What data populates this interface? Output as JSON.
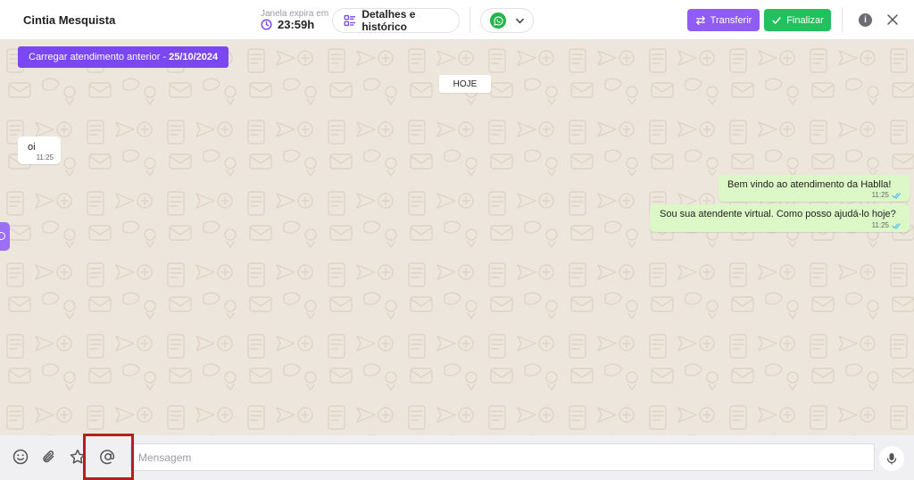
{
  "header": {
    "contact_name": "Cintia Mesquista",
    "window_label": "Janela expira em",
    "window_time": "23:59h",
    "details_label": "Detalhes e histórico",
    "channel_icon": "whatsapp-icon",
    "transfer_label": "Transferir",
    "finish_label": "Finalizar"
  },
  "chat": {
    "load_previous_label": "Carregar atendimento anterior -",
    "load_previous_date": "25/10/2024",
    "date_separator": "HOJE",
    "messages": [
      {
        "direction": "in",
        "text": "oi",
        "time": "11:25"
      },
      {
        "direction": "out",
        "text": "Bem vindo ao atendimento da Hablla!",
        "time": "11:25",
        "status": "read"
      },
      {
        "direction": "out",
        "text": "Sou sua atendente virtual. Como posso ajudá-lo hoje?",
        "time": "11:25",
        "status": "read"
      }
    ]
  },
  "composer": {
    "placeholder": "Mensagem",
    "value": "",
    "icons": [
      "emoji-icon",
      "attach-icon",
      "star-icon",
      "mention-icon",
      "microphone-icon"
    ]
  },
  "colors": {
    "accent_purple": "#7b47f0",
    "transfer_button": "#8f5cf5",
    "finish_button": "#21c15e",
    "chat_background": "#ede6dc",
    "outgoing_bubble": "#dcf8c6",
    "highlight": "#b3201d"
  }
}
